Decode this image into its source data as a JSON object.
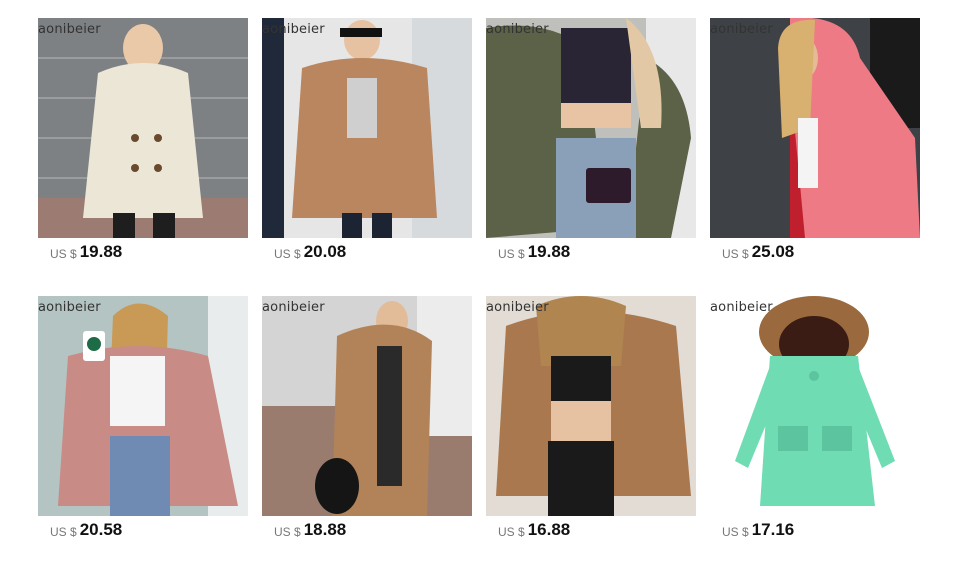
{
  "brand_watermark": "aonibeier",
  "products": [
    {
      "currency": "US $",
      "price": "19.88",
      "coat_color": "#ece6d7",
      "bg": "#8a8c8e",
      "coat_name": "cream double-breasted teddy coat"
    },
    {
      "currency": "US $",
      "price": "20.08",
      "coat_color": "#b9865f",
      "bg": "#e9e9e9",
      "coat_name": "tan teddy jacket"
    },
    {
      "currency": "US $",
      "price": "19.88",
      "coat_color": "#5b6247",
      "bg": "#c8c8c4",
      "coat_name": "olive teddy jacket"
    },
    {
      "currency": "US $",
      "price": "25.08",
      "coat_color": "#ee7a86",
      "bg": "#3b3f44",
      "coat_name": "pink hooded teddy coat"
    },
    {
      "currency": "US $",
      "price": "20.58",
      "coat_color": "#c98b86",
      "bg": "#b7c6c4",
      "coat_name": "pink shaggy faux fur coat"
    },
    {
      "currency": "US $",
      "price": "18.88",
      "coat_color": "#b28358",
      "bg": "#cfcfcf",
      "coat_name": "camel long teddy coat"
    },
    {
      "currency": "US $",
      "price": "16.88",
      "coat_color": "#a9784e",
      "bg": "#e3ddd6",
      "coat_name": "brown teddy jacket"
    },
    {
      "currency": "US $",
      "price": "17.16",
      "coat_color": "#6fdcb4",
      "bg": "#ffffff",
      "coat_name": "mint parka with fur hood"
    }
  ]
}
